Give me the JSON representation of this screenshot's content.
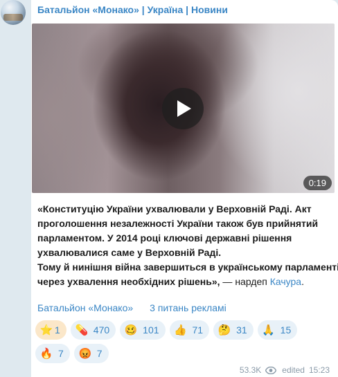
{
  "channel": {
    "name": "Батальйон «Монако» | Україна | Новини"
  },
  "video": {
    "duration": "0:19"
  },
  "post": {
    "line1": "«Конституцію України ухвалювали у Верховній Раді. Акт",
    "line2": "проголошення незалежності України також був прийнятий",
    "line3": "парламентом. У 2014 році ключові державні рішення",
    "line4": "ухвалювалися саме у Верховній Раді.",
    "line5": "Тому й нинішня війна завершиться в українському парламенті",
    "line6_bold": "через ухвалення необхідних рішень»,",
    "line6_plain": " — нардеп ",
    "link": "Качура",
    "end": "."
  },
  "links": {
    "first": "Батальйон «Монако»",
    "second": "3 питань рекламі"
  },
  "reactions": [
    {
      "emoji": "⭐",
      "count": "1",
      "icon": "star-icon"
    },
    {
      "emoji": "💊",
      "count": "470",
      "icon": "pill-icon"
    },
    {
      "emoji": "🥴",
      "count": "101",
      "icon": "woozy-face-icon"
    },
    {
      "emoji": "👍",
      "count": "71",
      "icon": "thumbs-up-icon"
    },
    {
      "emoji": "🤔",
      "count": "31",
      "icon": "thinking-face-icon"
    },
    {
      "emoji": "🙏",
      "count": "15",
      "icon": "folded-hands-icon"
    },
    {
      "emoji": "🔥",
      "count": "7",
      "icon": "fire-icon"
    },
    {
      "emoji": "😡",
      "count": "7",
      "icon": "angry-face-icon"
    }
  ],
  "meta": {
    "views": "53.3K",
    "edited": "edited",
    "time": "15:23"
  },
  "colors": {
    "link": "#3a86c5",
    "background": "#dfe9ef",
    "reaction_bg": "#e8f1f8",
    "reaction_active_bg": "#fbe7c9"
  }
}
